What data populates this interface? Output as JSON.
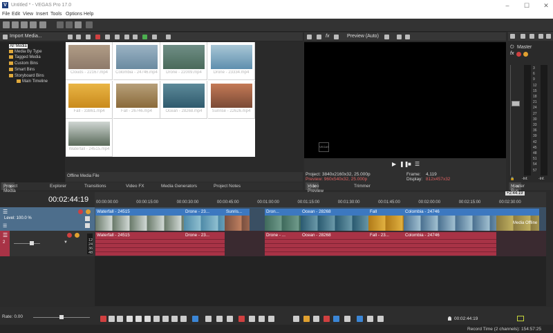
{
  "window": {
    "title": "Untitled * - VEGAS Pro 17.0",
    "app_icon": "V"
  },
  "menu": [
    "File",
    "Edit",
    "View",
    "Insert",
    "Tools",
    "Options",
    "Help"
  ],
  "media_toolbar": {
    "import_label": "Import Media..."
  },
  "tree": [
    {
      "label": "All Media",
      "selected": true
    },
    {
      "label": "Media By Type"
    },
    {
      "label": "Tagged Media"
    },
    {
      "label": "Custom Bins"
    },
    {
      "label": "Smart Bins"
    },
    {
      "label": "Storyboard Bins"
    },
    {
      "label": "Main Timeline"
    }
  ],
  "media": [
    {
      "name": "Clouds - 22167.mp4",
      "c1": "#8e7a6a",
      "c2": "#b09c86"
    },
    {
      "name": "Colombia - 24746.mp4",
      "c1": "#6a8aa0",
      "c2": "#9bb3c4"
    },
    {
      "name": "Drone - 22009.mp4",
      "c1": "#4a6a5a",
      "c2": "#6f8e86"
    },
    {
      "name": "Drone - 23334.mp4",
      "c1": "#5f8fae",
      "c2": "#a9c7d6"
    },
    {
      "name": "Fall - 33861.mp4",
      "c1": "#c98a1c",
      "c2": "#e9b545"
    },
    {
      "name": "Fall - 26746.mp4",
      "c1": "#8a6a3a",
      "c2": "#b7a07a"
    },
    {
      "name": "Ocean - 28268.mp4",
      "c1": "#2f5a6d",
      "c2": "#5d8a99"
    },
    {
      "name": "Sunrise - 22626.mp4",
      "c1": "#7a4a36",
      "c2": "#c47a56"
    },
    {
      "name": "Waterfall - 24515.mp4",
      "c1": "#5a6a5a",
      "c2": "#cfd6d2"
    }
  ],
  "offline_label": "Offline Media File",
  "bottom_tabs_left": [
    "Project Media",
    "Explorer",
    "Transitions",
    "Video FX",
    "Media Generators",
    "Project Notes"
  ],
  "preview": {
    "dropdown": "Preview (Auto)",
    "project": "Project:  3840x2160x32, 25.000p",
    "preview": "Preview:  960x540x32, 25.000p",
    "frame_label": "Frame:",
    "frame": "4,119",
    "display_label": "Display:",
    "display": "812x457x32",
    "tabs": [
      "Video Preview",
      "Trimmer"
    ],
    "logo": "VEGAS"
  },
  "mixer": {
    "label": "Master",
    "tab": "Master Bus",
    "scale": [
      "3",
      "6",
      "9",
      "12",
      "15",
      "18",
      "21",
      "24",
      "27",
      "30",
      "33",
      "36",
      "39",
      "42",
      "45",
      "48",
      "51",
      "54",
      "57"
    ],
    "minus": "-Inf.",
    "minus2": "-Inf."
  },
  "timeline": {
    "time": "00:02:44:19",
    "ruler": [
      "00:00:00:00",
      "00:00:15:00",
      "00:00:30:00",
      "00:00:45:00",
      "00:01:00:00",
      "00:01:15:00",
      "00:01:30:00",
      "00:01:45:00",
      "00:02:00:00",
      "00:02:15:00",
      "00:02:30:00"
    ],
    "end_marker": "+2:44:19",
    "level": "Level: 100.0 %",
    "audio_scale": [
      "12",
      "24",
      "36",
      "48"
    ],
    "video_clips": [
      {
        "name": "Waterfall - 24515",
        "c1": "#6a7a6a",
        "c2": "#d0d8d4"
      },
      {
        "name": "Drone - 23...",
        "c1": "#4e8aa8",
        "c2": "#8fbfd0"
      },
      {
        "name": "Sunris...",
        "c1": "#7a5040",
        "c2": "#c08060"
      },
      {
        "name": "Dron...",
        "c1": "#3f6a5c",
        "c2": "#6f9a8a"
      },
      {
        "name": "Ocean - 28268",
        "c1": "#2a5a70",
        "c2": "#6a98a8"
      },
      {
        "name": "Fall",
        "c1": "#b07a18",
        "c2": "#e0b040"
      },
      {
        "name": "Colombia - 24746",
        "c1": "#4a7090",
        "c2": "#a0bfd0"
      },
      {
        "name": "",
        "c1": "#8a7a40",
        "c2": "#c0b060"
      }
    ],
    "audio_clips": [
      "Waterfall - 24515",
      "Drone - 23...",
      "Drone - ...",
      "Ocean - 28268",
      "Fall - 23...",
      "Colombia - 24746"
    ],
    "last_clip_label": "Media Offline"
  },
  "rate": "Rate: 0.00",
  "transport_time": "00:02:44:19",
  "record_time": "Record Time (2 channels): 154:57:25"
}
